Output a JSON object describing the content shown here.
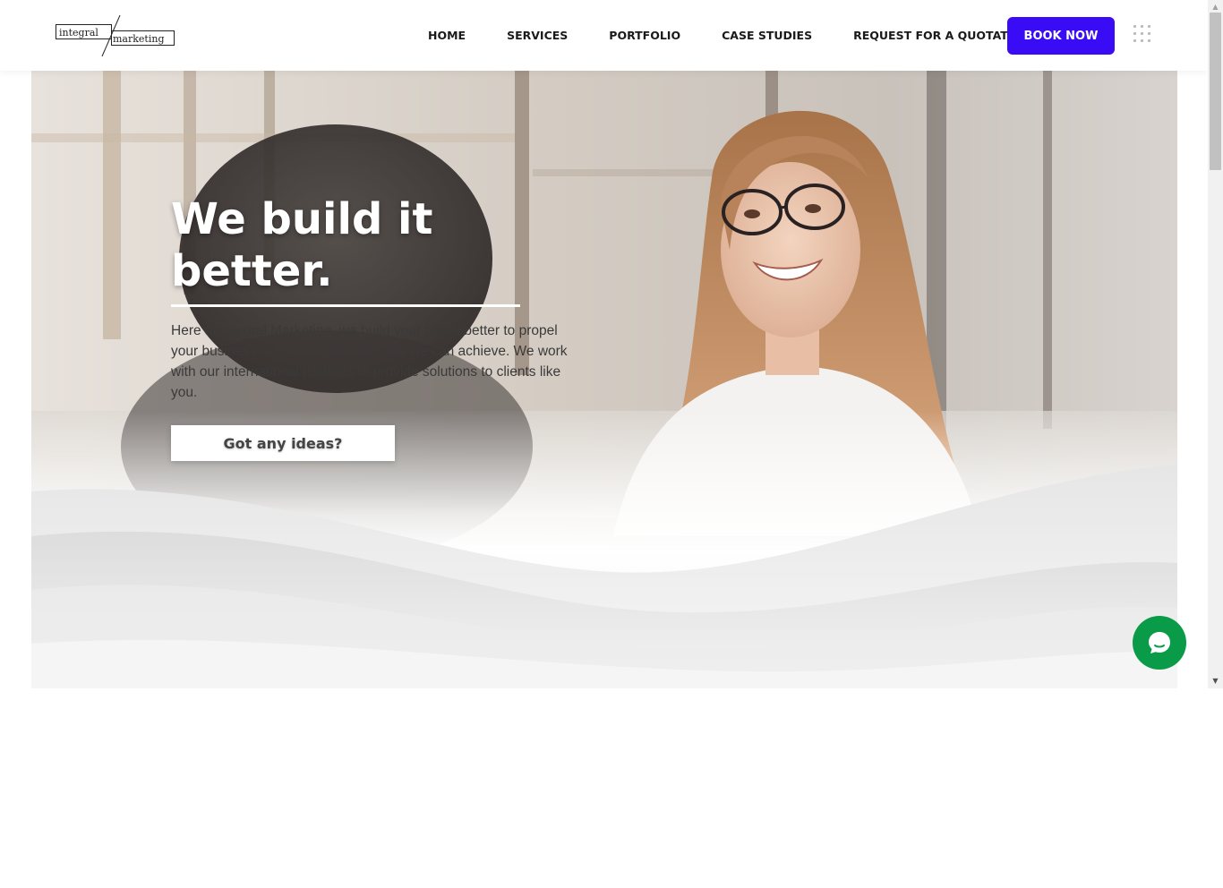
{
  "header": {
    "logo": {
      "word1": "integral",
      "word2": "marketing"
    },
    "nav": [
      {
        "label": "HOME"
      },
      {
        "label": "SERVICES"
      },
      {
        "label": "PORTFOLIO"
      },
      {
        "label": "CASE STUDIES"
      },
      {
        "label": "REQUEST FOR A QUOTATION"
      }
    ],
    "cta_label": "BOOK NOW",
    "cta_color": "#3a0cf5",
    "menu_icon": "grid-dots-icon"
  },
  "hero": {
    "title": "We build it better.",
    "description": "Here at Integral Marketing, we build your brand better to propel your business to new heights that only we can achieve. We work with our international partners to provide solutions to clients like you.",
    "button_label": "Got any ideas?"
  },
  "chat": {
    "icon": "chat-bubble-icon",
    "color": "#0a9b48"
  }
}
